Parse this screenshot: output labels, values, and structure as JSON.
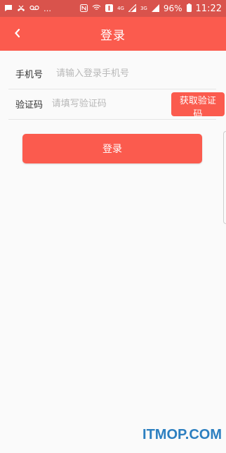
{
  "status_bar": {
    "left_icons": [
      "message-icon",
      "missed-call-icon",
      "voicemail-icon"
    ],
    "more": "…",
    "right_icons": [
      "nfc-icon",
      "wifi-icon",
      "notification-icon"
    ],
    "signal_4g": "4G",
    "signal_3g": "3G",
    "battery": "96%",
    "time": "11:22"
  },
  "header": {
    "title": "登录",
    "back_icon": "chevron-left-icon"
  },
  "form": {
    "phone_label": "手机号",
    "phone_placeholder": "请输入登录手机号",
    "code_label": "验证码",
    "code_placeholder": "请填写验证码",
    "get_code_label": "获取验证码"
  },
  "login_label": "登录",
  "watermark": "ITMOP.COM",
  "colors": {
    "accent": "#fb5b4e",
    "status_bar": "#d9534c",
    "background": "#fafafa",
    "watermark": "#2c7fc0"
  }
}
